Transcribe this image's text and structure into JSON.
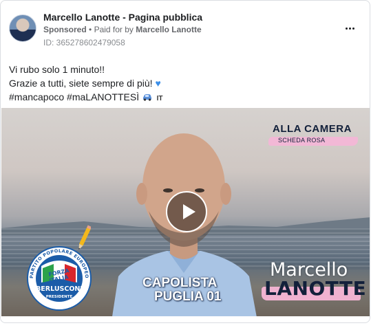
{
  "post": {
    "page_name": "Marcello Lanotte - Pagina pubblica",
    "sponsored": "Sponsored",
    "separator": "•",
    "paid_for_prefix": "Paid for by",
    "paid_for_name": "Marcello Lanotte",
    "id_text": "ID: 365278602479058",
    "caption": {
      "line1": "Vi rubo solo 1 minuto!!",
      "line2": "Grazie a tutti, siete sempre di più!",
      "line3": "#mancapoco #maLANOTTESÌ",
      "lang_tag": "IT"
    },
    "icons": {
      "avatar": "profile-photo",
      "more": "more-options-icon",
      "heart": "blue-heart-emoji",
      "car": "car-emoji",
      "play": "play-icon"
    }
  },
  "video": {
    "alla_camera": "ALLA CAMERA",
    "scheda_rosa": "SCHEDA ROSA",
    "capolista": "CAPOLISTA",
    "puglia": "PUGLIA 01",
    "first_name": "Marcello",
    "last_name": "LANOTTE",
    "logo": {
      "arc_text": "PARTITO POPOLARE EUROPEO",
      "forza": "FORZA",
      "italia": "ITALIA",
      "berlusconi": "BERLUSCONI",
      "presidente": "PRESIDENTE"
    }
  },
  "colors": {
    "page_name": "#1c1e21",
    "meta": "#65676b",
    "navy": "#12203a",
    "pink": "#f0b2d0",
    "heart": "#3b8ee8"
  }
}
